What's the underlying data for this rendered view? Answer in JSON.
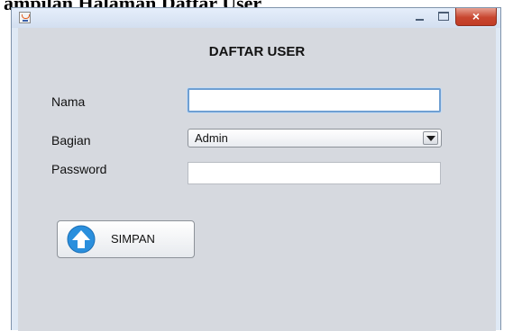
{
  "document": {
    "caption": "ampilan Halaman Daftar User"
  },
  "window": {
    "close_glyph": "×"
  },
  "form": {
    "title": "DAFTAR USER",
    "fields": {
      "nama": {
        "label": "Nama",
        "value": ""
      },
      "bagian": {
        "label": "Bagian",
        "selected": "Admin"
      },
      "password": {
        "label": "Password",
        "value": ""
      }
    },
    "save_button": {
      "label": "SIMPAN",
      "icon": "upload-arrow-icon"
    }
  },
  "colors": {
    "window_frame": "#dfe9f5",
    "panel_bg": "#d6d9df",
    "close_button": "#c8462f",
    "focus_border": "#6f9fd2",
    "save_icon": "#2a8fdd"
  }
}
